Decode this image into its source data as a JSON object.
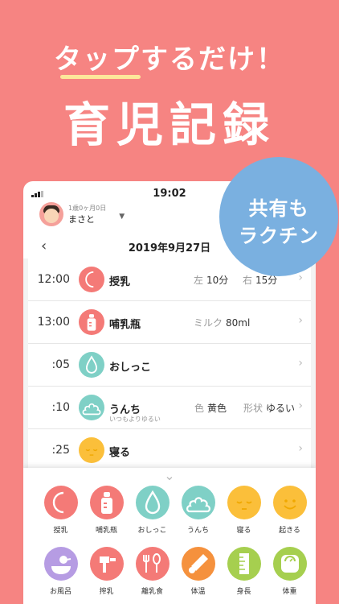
{
  "hero": {
    "subtitle": "タップするだけ！",
    "title": "育児記録"
  },
  "badge": {
    "line1": "共有も",
    "line2": "ラクチン"
  },
  "status_bar": {
    "time": "19:02"
  },
  "profile": {
    "age": "1歳0ヶ月0日",
    "name": "まさと",
    "dropdown_icon": "caret-down-icon"
  },
  "date": {
    "back_icon": "chevron-left-icon",
    "label": "2019年9月27日"
  },
  "log_entries": [
    {
      "time": "12:00",
      "name": "授乳",
      "icon": "breastfeed-icon",
      "color": "#f47a77",
      "details": [
        {
          "label": "左",
          "value": "10分"
        },
        {
          "label": "右",
          "value": "15分"
        }
      ],
      "note": ""
    },
    {
      "time": "13:00",
      "name": "哺乳瓶",
      "icon": "bottle-icon",
      "color": "#f47a77",
      "details": [
        {
          "label": "ミルク",
          "value": "80ml"
        }
      ],
      "note": ""
    },
    {
      "time": ":05",
      "name": "おしっこ",
      "icon": "pee-icon",
      "color": "#7fd0c6",
      "details": [],
      "note": ""
    },
    {
      "time": ":10",
      "name": "うんち",
      "icon": "poop-icon",
      "color": "#7fd0c6",
      "details": [
        {
          "label": "色",
          "value": "黄色"
        },
        {
          "label": "形状",
          "value": "ゆるい"
        }
      ],
      "note": "いつもよりゆるい"
    },
    {
      "time": ":25",
      "name": "寝る",
      "icon": "sleep-icon",
      "color": "#fbbf3a",
      "details": [],
      "note": ""
    }
  ],
  "quick_buttons_row1": [
    {
      "label": "授乳",
      "icon": "breastfeed-icon",
      "color": "#f47a77"
    },
    {
      "label": "哺乳瓶",
      "icon": "bottle-icon",
      "color": "#f47a77"
    },
    {
      "label": "おしっこ",
      "icon": "pee-icon",
      "color": "#7fd0c6"
    },
    {
      "label": "うんち",
      "icon": "poop-icon",
      "color": "#7fd0c6"
    },
    {
      "label": "寝る",
      "icon": "sleep-icon",
      "color": "#fbbf3a"
    },
    {
      "label": "起きる",
      "icon": "wake-icon",
      "color": "#fbbf3a"
    }
  ],
  "quick_buttons_row2": [
    {
      "label": "お風呂",
      "icon": "bath-icon",
      "color": "#b69ce3"
    },
    {
      "label": "搾乳",
      "icon": "pump-icon",
      "color": "#f47a77"
    },
    {
      "label": "離乳食",
      "icon": "babyfood-icon",
      "color": "#f47a77"
    },
    {
      "label": "体温",
      "icon": "thermometer-icon",
      "color": "#f5913d"
    },
    {
      "label": "身長",
      "icon": "ruler-icon",
      "color": "#a6cf4f"
    },
    {
      "label": "体重",
      "icon": "scale-icon",
      "color": "#a6cf4f"
    }
  ],
  "colors": {
    "background": "#f68482",
    "badge": "#7ab0e0",
    "underline": "#fde79a"
  }
}
